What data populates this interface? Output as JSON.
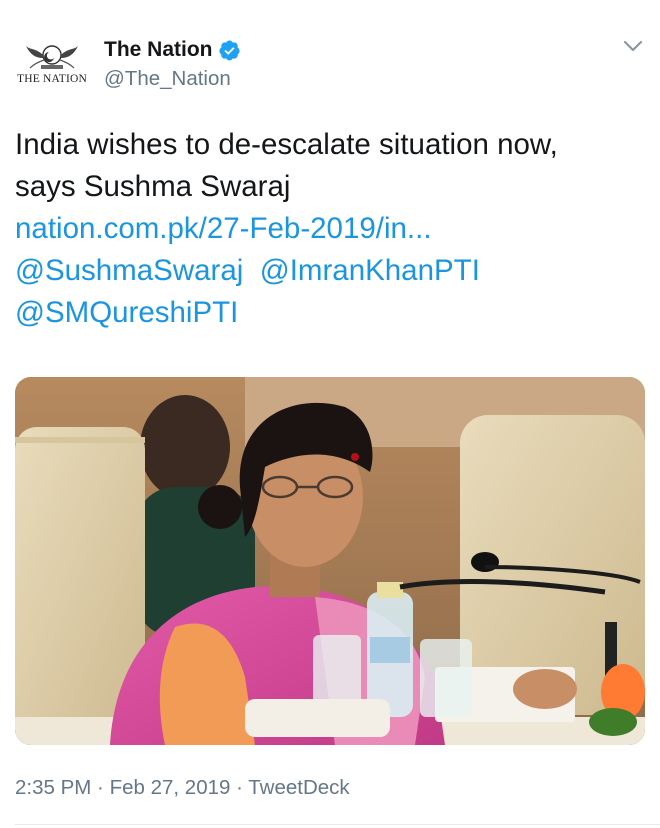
{
  "account": {
    "display_name": "The Nation",
    "handle": "@The_Nation",
    "logo_text": "THE NATION",
    "verified": true
  },
  "tweet": {
    "text_line1": "India wishes to de-escalate situation now,",
    "text_line2": "says Sushma Swaraj",
    "link": "nation.com.pk/27-Feb-2019/in...",
    "mention1": "@SushmaSwaraj",
    "mention2": "@ImranKhanPTI",
    "mention3": "@SMQureshiPTI"
  },
  "meta": {
    "time": "2:35 PM",
    "separator1": " · ",
    "date": "Feb 27, 2019",
    "separator2": " · ",
    "source": "TweetDeck"
  },
  "colors": {
    "link": "#1b95e0",
    "secondary_text": "#657786",
    "verified_badge": "#1da1f2"
  },
  "icons": {
    "verified": "verified-badge-icon",
    "menu": "chevron-down-icon"
  },
  "media": {
    "description_icon": "photo"
  }
}
